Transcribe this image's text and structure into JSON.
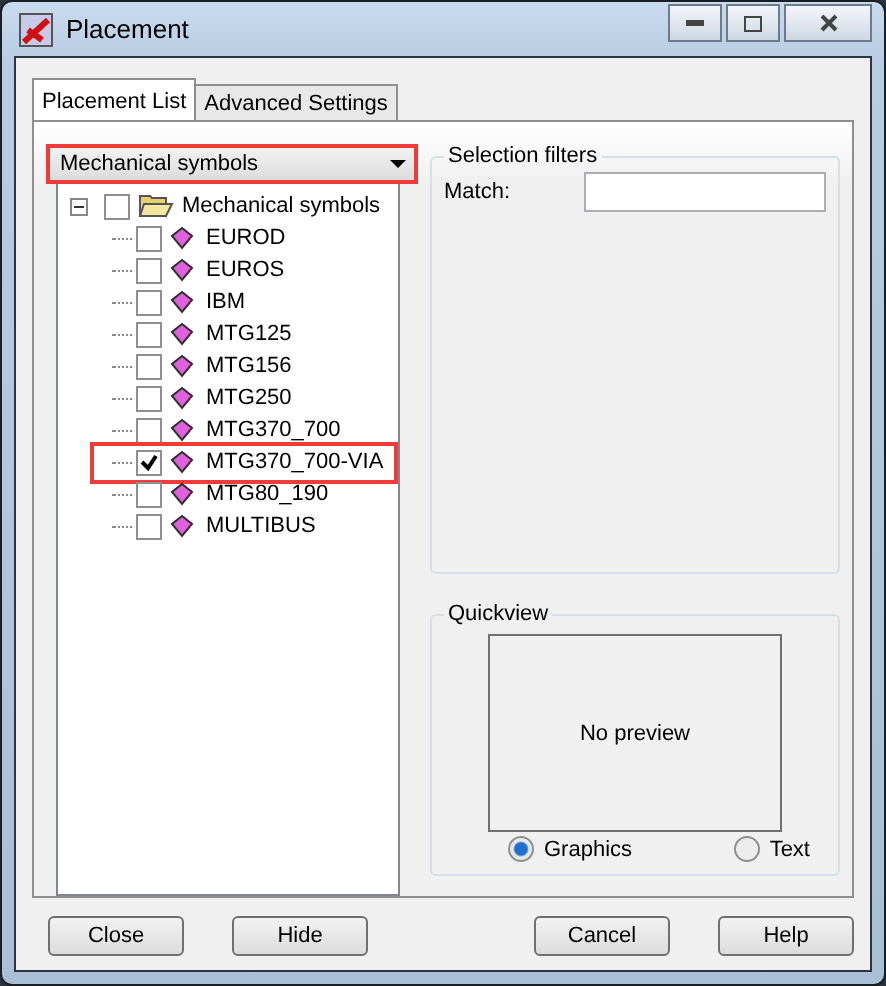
{
  "window": {
    "title": "Placement"
  },
  "tabs": [
    {
      "label": "Placement List",
      "selected": true
    },
    {
      "label": "Advanced Settings",
      "selected": false
    }
  ],
  "dropdown": {
    "value": "Mechanical symbols",
    "highlighted": true
  },
  "tree": {
    "label": "Mechanical symbols",
    "checked": false,
    "expanded": true,
    "children": [
      {
        "label": "EUROD",
        "checked": false,
        "highlighted": false
      },
      {
        "label": "EUROS",
        "checked": false,
        "highlighted": false
      },
      {
        "label": "IBM",
        "checked": false,
        "highlighted": false
      },
      {
        "label": "MTG125",
        "checked": false,
        "highlighted": false
      },
      {
        "label": "MTG156",
        "checked": false,
        "highlighted": false
      },
      {
        "label": "MTG250",
        "checked": false,
        "highlighted": false
      },
      {
        "label": "MTG370_700",
        "checked": false,
        "highlighted": false
      },
      {
        "label": "MTG370_700-VIA",
        "checked": true,
        "highlighted": true
      },
      {
        "label": "MTG80_190",
        "checked": false,
        "highlighted": false
      },
      {
        "label": "MULTIBUS",
        "checked": false,
        "highlighted": false
      }
    ]
  },
  "selection_filters": {
    "title": "Selection filters",
    "match_label": "Match:"
  },
  "quickview": {
    "title": "Quickview",
    "preview_text": "No preview",
    "options": [
      {
        "label": "Graphics",
        "selected": true
      },
      {
        "label": "Text",
        "selected": false
      }
    ]
  },
  "buttons": [
    "Close",
    "Hide",
    "Cancel",
    "Help"
  ]
}
